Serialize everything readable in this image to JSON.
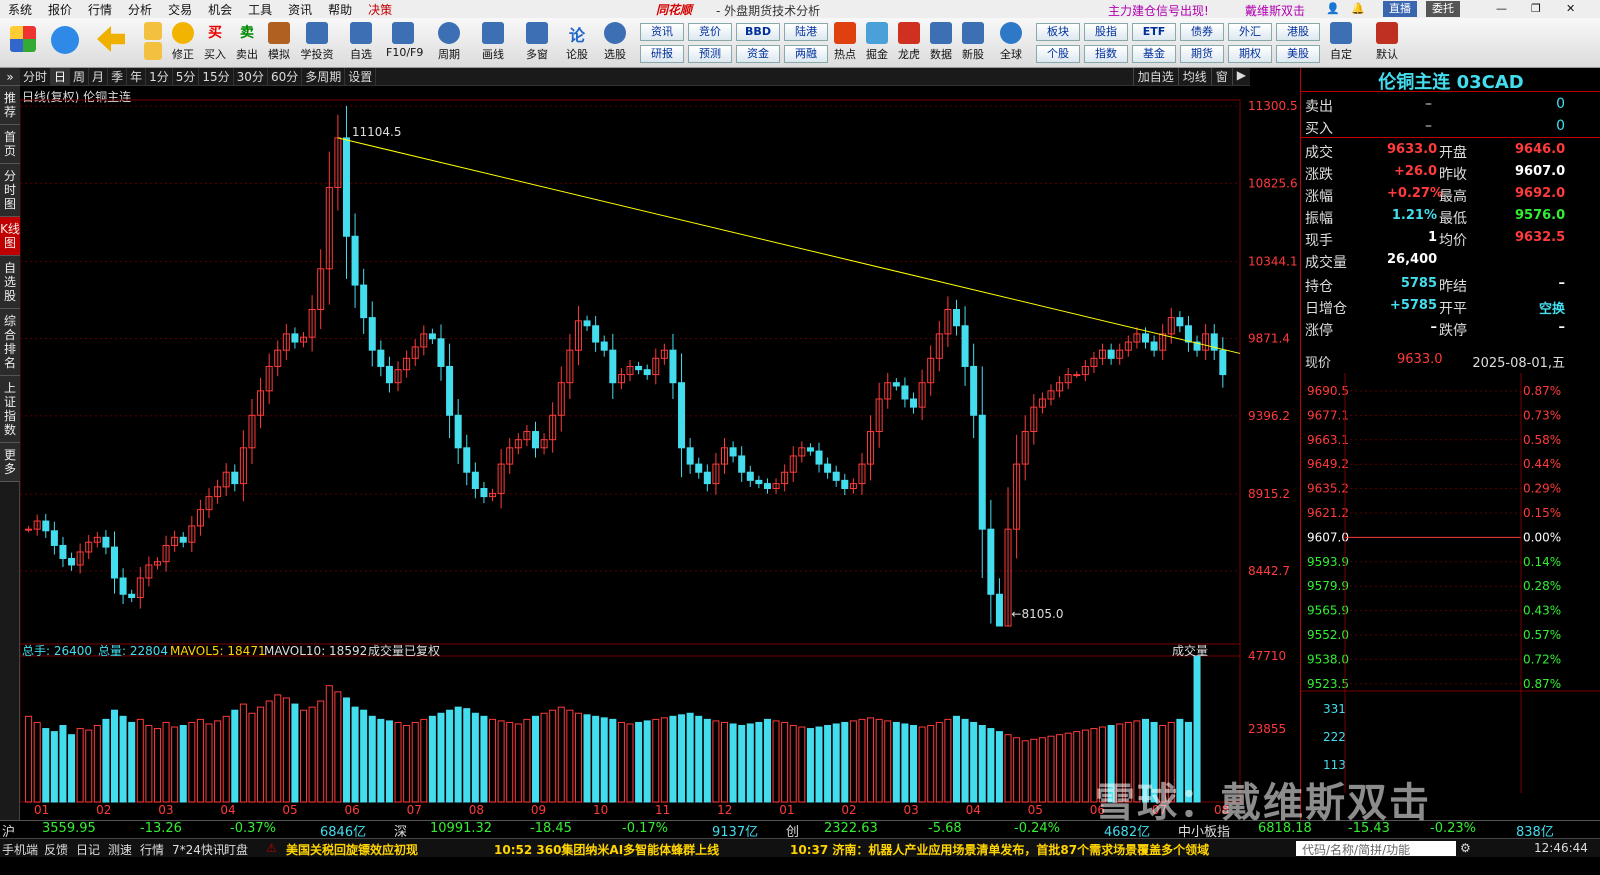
{
  "menubar": {
    "items": [
      "系统",
      "报价",
      "行情",
      "分析",
      "交易",
      "机会",
      "工具",
      "资讯",
      "帮助",
      "决策"
    ],
    "brand": "同花顺",
    "subtitle": "- 外盘期货技术分析",
    "signal": "主力建仓信号出现!",
    "signal2": "戴维斯双击",
    "live": "直播",
    "broker": "委托"
  },
  "toolbar": {
    "buttons": [
      "修正",
      "买入",
      "卖出",
      "模拟",
      "学投资",
      "自选",
      "F10/F9",
      "周期",
      "画线",
      "多窗",
      "论股",
      "选股"
    ],
    "grid_buttons": [
      [
        "资讯",
        "竞价",
        "BBD",
        "陆港"
      ],
      [
        "研报",
        "预测",
        "资金",
        "两融"
      ]
    ],
    "right_buttons": [
      "热点",
      "掘金",
      "龙虎",
      "数据",
      "新股",
      "全球"
    ],
    "grid2": [
      [
        "板块",
        "股指",
        "ETF",
        "债券",
        "外汇",
        "港股"
      ],
      [
        "个股",
        "指数",
        "基金",
        "期货",
        "期权",
        "美股"
      ]
    ],
    "far": [
      "自定",
      "默认"
    ]
  },
  "leftnav": [
    "推荐",
    "首页",
    "分时图",
    "K线图",
    "自选股",
    "综合排名",
    "上证指数",
    "更多"
  ],
  "periods": [
    "分时",
    "日",
    "周",
    "月",
    "季",
    "年",
    "1分",
    "5分",
    "15分",
    "30分",
    "60分",
    "多周期",
    "设置"
  ],
  "period_selected": "日",
  "period_right": [
    "加自选",
    "均线",
    "窗",
    "▶"
  ],
  "chart_title": "日线(复权) 伦铜主连",
  "chart_data": {
    "type": "candlestick",
    "title": "日线(复权) 伦铜主连",
    "price_axis": [
      11300.5,
      10825.6,
      10344.1,
      9871.4,
      9396.2,
      8915.2,
      8442.7
    ],
    "ylim": [
      8105.0,
      11300.5
    ],
    "annotations": [
      {
        "label": "11104.5",
        "kind": "high"
      },
      {
        "label": "8105.0",
        "kind": "low"
      }
    ],
    "trendline": {
      "from": 11104.5,
      "to": 9780
    },
    "x_labels": [
      "01",
      "02",
      "03",
      "04",
      "05",
      "06",
      "07",
      "08",
      "09",
      "10",
      "11",
      "12",
      "01",
      "02",
      "03",
      "04",
      "05",
      "06",
      "07",
      "08"
    ],
    "volume_axis": [
      47710,
      23855
    ],
    "closes": [
      8700,
      8750,
      8690,
      8600,
      8520,
      8480,
      8560,
      8620,
      8650,
      8590,
      8400,
      8300,
      8280,
      8400,
      8480,
      8500,
      8600,
      8650,
      8620,
      8720,
      8820,
      8900,
      8960,
      9050,
      8980,
      9200,
      9400,
      9550,
      9700,
      9800,
      9900,
      9850,
      9880,
      10050,
      10300,
      10800,
      11104.5,
      10500,
      10200,
      10000,
      9800,
      9700,
      9600,
      9680,
      9750,
      9820,
      9900,
      9870,
      9700,
      9400,
      9200,
      9050,
      8950,
      8900,
      8920,
      9100,
      9200,
      9250,
      9300,
      9200,
      9250,
      9400,
      9600,
      9800,
      9980,
      9950,
      9850,
      9800,
      9600,
      9650,
      9700,
      9680,
      9650,
      9750,
      9800,
      9600,
      9200,
      9100,
      9050,
      8980,
      9100,
      9200,
      9150,
      9050,
      9000,
      8980,
      8950,
      8980,
      9050,
      9150,
      9200,
      9180,
      9100,
      9050,
      9000,
      8950,
      8980,
      9100,
      9300,
      9500,
      9600,
      9580,
      9500,
      9450,
      9600,
      9750,
      9900,
      10050,
      9950,
      9700,
      9400,
      8700,
      8300,
      8105,
      8700,
      9100,
      9300,
      9450,
      9500,
      9550,
      9600,
      9650,
      9650,
      9700,
      9750,
      9800,
      9750,
      9800,
      9850,
      9900,
      9850,
      9800,
      9900,
      10000,
      9950,
      9850,
      9800,
      9900,
      9800,
      9650
    ],
    "volumes": [
      28000,
      26000,
      24000,
      23000,
      25000,
      22000,
      24000,
      23500,
      25000,
      27000,
      30000,
      28000,
      26000,
      27000,
      25000,
      24000,
      26000,
      24500,
      25000,
      26000,
      27000,
      25500,
      26500,
      28000,
      30000,
      32000,
      29000,
      31000,
      33000,
      35000,
      34000,
      32000,
      30000,
      31000,
      33000,
      38000,
      36000,
      34000,
      31000,
      30000,
      28000,
      27000,
      26500,
      26000,
      25000,
      26000,
      27000,
      28000,
      29000,
      30000,
      31000,
      30500,
      29000,
      28000,
      27000,
      26500,
      26000,
      25500,
      27000,
      28000,
      29000,
      30000,
      31000,
      30000,
      29000,
      28500,
      28000,
      27500,
      27000,
      26000,
      25500,
      26000,
      26500,
      27000,
      27500,
      28000,
      28500,
      29000,
      28000,
      27000,
      26500,
      26000,
      25500,
      25000,
      25500,
      26000,
      27000,
      26500,
      26000,
      25000,
      24500,
      24000,
      24500,
      25000,
      25500,
      26000,
      26500,
      27000,
      27500,
      27000,
      26500,
      26000,
      25500,
      25000,
      24500,
      25000,
      26000,
      27000,
      28000,
      27000,
      26000,
      25000,
      24000,
      23000,
      22000,
      21000,
      20000,
      20500,
      21000,
      21500,
      22000,
      22500,
      23000,
      23500,
      24000,
      24500,
      25000,
      25500,
      26000,
      26500,
      27000,
      26000,
      25000,
      26000,
      27000,
      26000,
      47710
    ]
  },
  "volume_legend": {
    "total": "总手: 26400",
    "total_vol": "总量: 22804",
    "mavol5": "MAVOL5: 18471",
    "mavol10": "MAVOL10: 18592",
    "note": "成交量已复权",
    "selector": "成交量"
  },
  "quote": {
    "title": "伦铜主连 03CAD",
    "sell": {
      "label": "卖出",
      "price": "–",
      "vol": "0"
    },
    "buy": {
      "label": "买入",
      "price": "–",
      "vol": "0"
    },
    "rows": [
      {
        "l1": "成交",
        "v1": "9633.0",
        "l2": "开盘",
        "v2": "9646.0",
        "c1": "#ff3b3b",
        "c2": "#ff3b3b"
      },
      {
        "l1": "涨跌",
        "v1": "+26.0",
        "l2": "昨收",
        "v2": "9607.0",
        "c1": "#ff3b3b",
        "c2": "#ffffff"
      },
      {
        "l1": "涨幅",
        "v1": "+0.27%",
        "l2": "最高",
        "v2": "9692.0",
        "c1": "#ff3b3b",
        "c2": "#ff3b3b"
      },
      {
        "l1": "振幅",
        "v1": "1.21%",
        "l2": "最低",
        "v2": "9576.0",
        "c1": "#44ddee",
        "c2": "#33ee33"
      },
      {
        "l1": "现手",
        "v1": "1",
        "l2": "均价",
        "v2": "9632.5",
        "c1": "#ffffff",
        "c2": "#ff3b3b"
      },
      {
        "l1": "成交量",
        "v1": "26,400",
        "l2": "",
        "v2": "",
        "c1": "#ffffff",
        "c2": "#ffffff"
      },
      {
        "l1": "持仓",
        "v1": "5785",
        "l2": "昨结",
        "v2": "–",
        "c1": "#44ddee",
        "c2": "#ffffff"
      },
      {
        "l1": "日增仓",
        "v1": "+5785",
        "l2": "开平",
        "v2": "空换",
        "c1": "#44ddee",
        "c2": "#44ddee"
      },
      {
        "l1": "涨停",
        "v1": "–",
        "l2": "跌停",
        "v2": "–",
        "c1": "#ffffff",
        "c2": "#ffffff"
      }
    ],
    "now_label": "现价",
    "now_price": "9633.0",
    "date": "2025-08-01,五"
  },
  "mini_chart": {
    "prices": [
      "9690.5",
      "9677.1",
      "9663.1",
      "9649.2",
      "9635.2",
      "9621.2",
      "9607.0",
      "9593.9",
      "9579.9",
      "9565.9",
      "9552.0",
      "9538.0",
      "9523.5"
    ],
    "pcts": [
      "0.87%",
      "0.73%",
      "0.58%",
      "0.44%",
      "0.29%",
      "0.15%",
      "0.00%",
      "0.14%",
      "0.28%",
      "0.43%",
      "0.57%",
      "0.72%",
      "0.87%"
    ],
    "vol_labels": [
      "331",
      "222",
      "113"
    ]
  },
  "bottom_stats": {
    "sh": {
      "name": "沪",
      "value": "3559.95",
      "chg": "-13.26",
      "pct": "-0.37%",
      "amt": "6846亿"
    },
    "sz": {
      "name": "深",
      "value": "10991.32",
      "chg": "-18.45",
      "pct": "-0.17%",
      "amt": "9137亿"
    },
    "cy": {
      "name": "创",
      "value": "2322.63",
      "chg": "-5.68",
      "pct": "-0.24%",
      "amt": "4682亿"
    },
    "zx": {
      "name": "中小板指",
      "value": "6818.18",
      "chg": "-15.43",
      "pct": "-0.23%",
      "amt": "838亿"
    }
  },
  "news": {
    "tabs": [
      "手机端",
      "反馈",
      "日记",
      "测速",
      "行情",
      "7*24快讯",
      "盯盘"
    ],
    "items": [
      "美国关税回旋镖效应初现",
      "10:52 360集团纳米AI多智能体蜂群上线",
      "10:37 济南：机器人产业应用场景清单发布，首批87个需求场景覆盖多个领域"
    ],
    "search": "代码/名称/简拼/功能",
    "time": "12:46:44"
  },
  "watermark": "雪球：戴维斯双击",
  "colors": {
    "up": "#ff3b3b",
    "down": "#44ddee",
    "accent": "#c00000",
    "trend": "#ffff00"
  }
}
